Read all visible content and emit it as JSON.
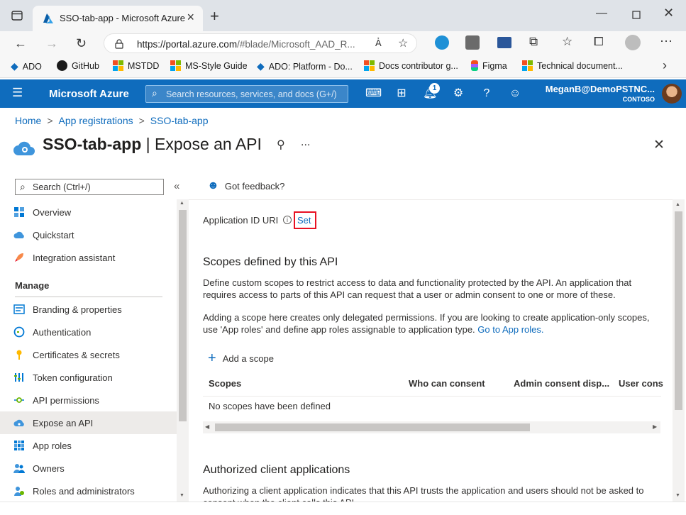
{
  "browser": {
    "tab_title": "SSO-tab-app - Microsoft Azure",
    "url_host": "https://portal.azure.com",
    "url_path": "/#blade/Microsoft_AAD_R...",
    "favorites": [
      "ADO",
      "GitHub",
      "MSTDD",
      "MS-Style Guide",
      "ADO: Platform - Do...",
      "Docs contributor g...",
      "Figma",
      "Technical document..."
    ]
  },
  "portal": {
    "brand": "Microsoft Azure",
    "search_placeholder": "Search resources, services, and docs (G+/)",
    "notification_count": "1",
    "user_name": "MeganB@DemoPSTNC...",
    "tenant": "CONTOSO"
  },
  "breadcrumb": [
    "Home",
    "App registrations",
    "SSO-tab-app"
  ],
  "page": {
    "app_name": "SSO-tab-app",
    "blade_title": "| Expose an API",
    "more": "..."
  },
  "sidebar": {
    "search_placeholder": "Search (Ctrl+/)",
    "collapse": "«",
    "top_items": [
      {
        "label": "Overview",
        "icon": "grid-icon"
      },
      {
        "label": "Quickstart",
        "icon": "cloud-icon"
      },
      {
        "label": "Integration assistant",
        "icon": "rocket-icon"
      }
    ],
    "group_label": "Manage",
    "manage_items": [
      {
        "label": "Branding & properties",
        "icon": "branding-icon"
      },
      {
        "label": "Authentication",
        "icon": "authentication-icon"
      },
      {
        "label": "Certificates & secrets",
        "icon": "key-icon"
      },
      {
        "label": "Token configuration",
        "icon": "token-icon"
      },
      {
        "label": "API permissions",
        "icon": "api-permissions-icon"
      },
      {
        "label": "Expose an API",
        "icon": "cloud-api-icon",
        "active": true
      },
      {
        "label": "App roles",
        "icon": "app-roles-icon"
      },
      {
        "label": "Owners",
        "icon": "owners-icon"
      },
      {
        "label": "Roles and administrators",
        "icon": "roles-icon"
      }
    ]
  },
  "main": {
    "feedback": "Got feedback?",
    "app_id_uri_label": "Application ID URI",
    "set_link": "Set",
    "scopes_title": "Scopes defined by this API",
    "scopes_desc": "Define custom scopes to restrict access to data and functionality protected by the API. An application that requires access to parts of this API can request that a user or admin consent to one or more of these.",
    "scopes_note": "Adding a scope here creates only delegated permissions. If you are looking to create application-only scopes, use 'App roles' and define app roles assignable to application type.",
    "go_to_app_roles": "Go to App roles.",
    "add_scope": "Add a scope",
    "table_headers": [
      "Scopes",
      "Who can consent",
      "Admin consent disp...",
      "User cons"
    ],
    "empty_message": "No scopes have been defined",
    "authorized_title": "Authorized client applications",
    "authorized_desc": "Authorizing a client application indicates that this API trusts the application and users should not be asked to consent when the client calls this API."
  },
  "colors": {
    "accent": "#0f6cbd",
    "highlight_box": "#e81123"
  }
}
